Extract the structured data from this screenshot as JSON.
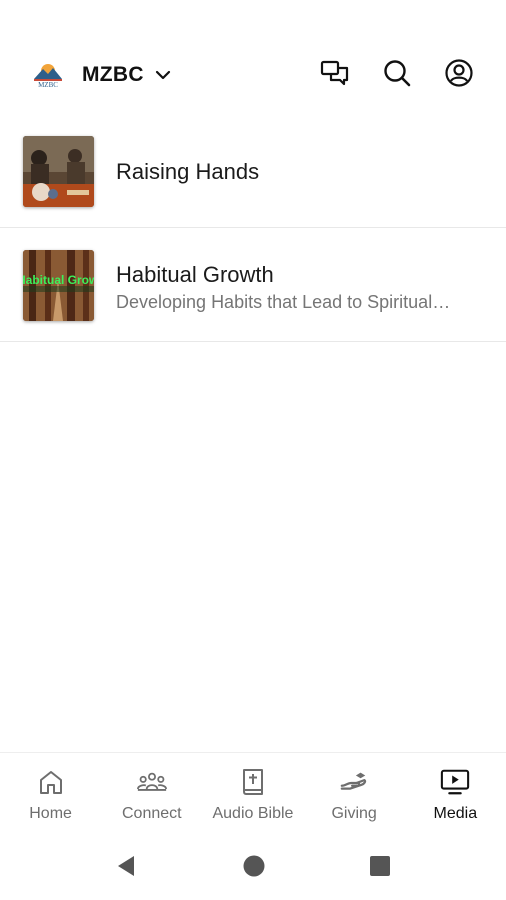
{
  "header": {
    "org_name": "MZBC",
    "logo_text": "MZBC",
    "icons": [
      "logo-icon",
      "chevron-down-icon",
      "chat-icon",
      "search-icon",
      "account-icon"
    ]
  },
  "media_list": [
    {
      "title": "Raising Hands",
      "subtitle": "",
      "thumbnail": "raising-hands-thumbnail"
    },
    {
      "title": "Habitual Growth",
      "subtitle": "Developing Habits that Lead to Spiritual…",
      "thumbnail": "habitual-growth-thumbnail",
      "thumb_text": "Habitual Grow"
    }
  ],
  "tabbar": {
    "tabs": [
      {
        "label": "Home",
        "icon": "home-icon",
        "active": false
      },
      {
        "label": "Connect",
        "icon": "people-icon",
        "active": false
      },
      {
        "label": "Audio Bible",
        "icon": "bible-icon",
        "active": false
      },
      {
        "label": "Giving",
        "icon": "giving-hand-icon",
        "active": false
      },
      {
        "label": "Media",
        "icon": "tv-play-icon",
        "active": true
      }
    ]
  },
  "system_nav": [
    "back-icon",
    "home-circle-icon",
    "recents-square-icon"
  ],
  "colors": {
    "active": "#111111",
    "inactive": "#6e6e6e",
    "divider": "#e8e8e8"
  }
}
